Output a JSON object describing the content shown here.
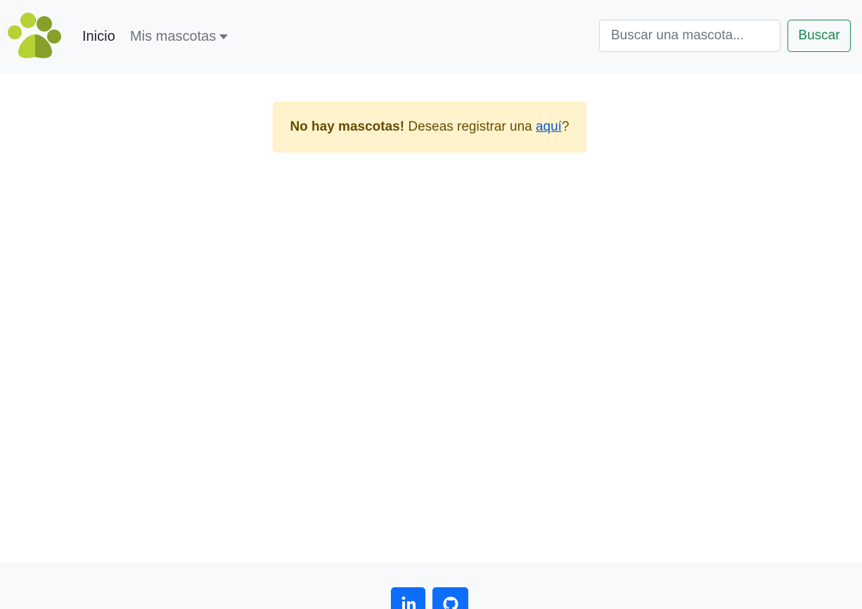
{
  "navbar": {
    "logo_icon": "paw-icon",
    "home_label": "Inicio",
    "pets_menu_label": "Mis mascotas",
    "search": {
      "placeholder": "Buscar una mascota...",
      "value": ""
    },
    "search_button_label": "Buscar"
  },
  "alert": {
    "strong_text": "No hay mascotas!",
    "message_text": " Deseas registrar una ",
    "link_text": "aquí",
    "trailing_text": "?"
  },
  "footer": {
    "social_links": [
      {
        "icon": "linkedin-icon"
      },
      {
        "icon": "github-icon"
      }
    ]
  },
  "colors": {
    "navbar_bg": "#f8f9fa",
    "success": "#198754",
    "warning_bg": "#fff3cd",
    "warning_text": "#664d03",
    "primary": "#0d6efd",
    "paw_light": "#b5d334",
    "paw_dark": "#86a02a"
  }
}
